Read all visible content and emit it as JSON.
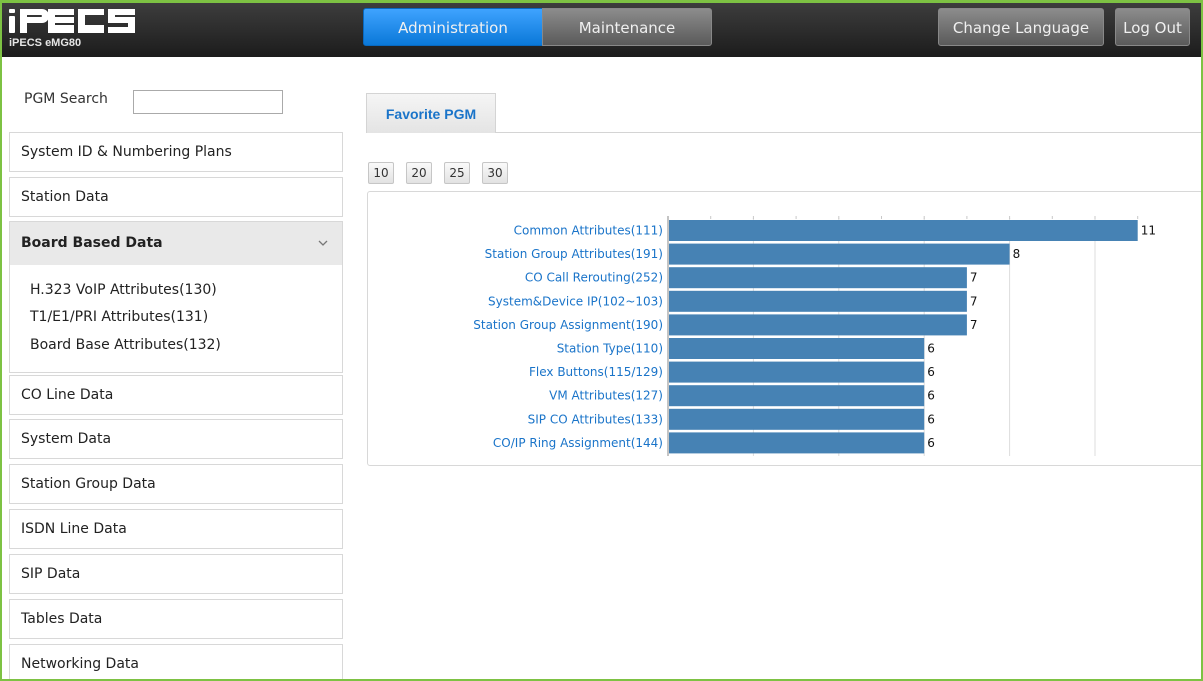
{
  "header": {
    "logo_text": "iPECS",
    "model": "iPECS eMG80",
    "buttons": {
      "administration": "Administration",
      "maintenance": "Maintenance",
      "change_language": "Change Language",
      "log_out": "Log Out"
    },
    "active_button": "administration",
    "accent_color": "#0a78d8",
    "frame_color": "#7dc243"
  },
  "sidebar": {
    "search_label": "PGM Search",
    "search_value": "",
    "items_before": [
      {
        "label": "System ID & Numbering Plans"
      },
      {
        "label": "Station Data"
      }
    ],
    "expanded": {
      "label": "Board Based Data",
      "icon": "chevron-down-icon",
      "children": [
        {
          "label": "H.323 VoIP Attributes(130)"
        },
        {
          "label": "T1/E1/PRI Attributes(131)"
        },
        {
          "label": "Board Base Attributes(132)"
        }
      ]
    },
    "items_after": [
      {
        "label": "CO Line Data"
      },
      {
        "label": "System Data"
      },
      {
        "label": "Station Group Data"
      },
      {
        "label": "ISDN Line Data"
      },
      {
        "label": "SIP Data"
      },
      {
        "label": "Tables Data"
      },
      {
        "label": "Networking Data"
      }
    ]
  },
  "main": {
    "tab_label": "Favorite PGM",
    "page_sizes": [
      "10",
      "20",
      "25",
      "30"
    ]
  },
  "chart_data": {
    "type": "bar",
    "orientation": "horizontal",
    "bar_color": "#4682b4",
    "label_color": "#1a74c9",
    "grid": true,
    "xlim": [
      0,
      11
    ],
    "categories": [
      "Common Attributes(111)",
      "Station Group Attributes(191)",
      "CO Call Rerouting(252)",
      "System&Device IP(102~103)",
      "Station Group Assignment(190)",
      "Station Type(110)",
      "Flex Buttons(115/129)",
      "VM Attributes(127)",
      "SIP CO Attributes(133)",
      "CO/IP Ring Assignment(144)"
    ],
    "values": [
      11,
      8,
      7,
      7,
      7,
      6,
      6,
      6,
      6,
      6
    ]
  }
}
